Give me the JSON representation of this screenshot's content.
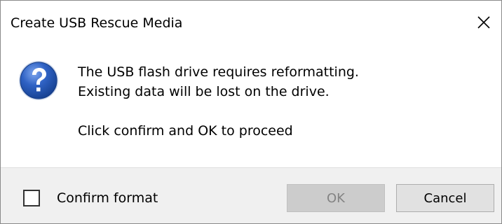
{
  "window": {
    "title": "Create USB Rescue Media",
    "close_icon": "close-icon"
  },
  "message": {
    "icon": "question-icon",
    "line1": "The USB flash drive requires reformatting.",
    "line2": "Existing data will be lost on the drive.",
    "line3": "Click confirm and OK to proceed"
  },
  "footer": {
    "checkbox_label": "Confirm format",
    "checkbox_checked": false,
    "ok_label": "OK",
    "ok_enabled": false,
    "cancel_label": "Cancel"
  },
  "colors": {
    "icon_blue": "#1f4fa8",
    "footer_bg": "#f0f0f0",
    "checkbox_focus": "#333333"
  }
}
